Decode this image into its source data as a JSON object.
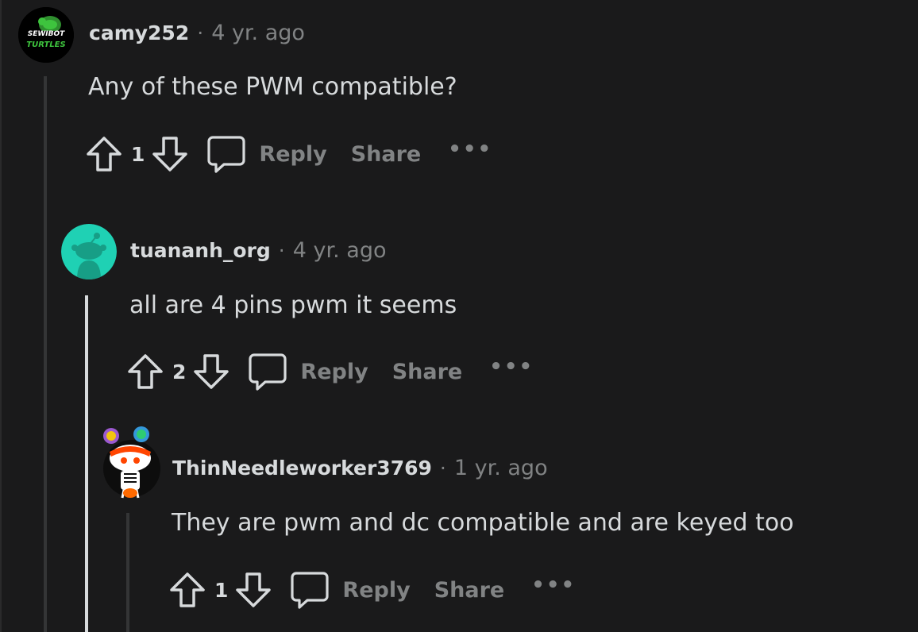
{
  "comments": [
    {
      "author": "camy252",
      "separator": "·",
      "time": "4 yr. ago",
      "body": "Any of these PWM compatible?",
      "score": "1",
      "reply_label": "Reply",
      "share_label": "Share",
      "more_label": "•••",
      "avatar_text_top": "SEWIBOT",
      "avatar_text_bottom": "TURTLES",
      "avatar_colors": {
        "bg": "#000000",
        "text": "#3ec43e"
      }
    },
    {
      "author": "tuananh_org",
      "separator": "·",
      "time": "4 yr. ago",
      "body": "all are 4 pins pwm it seems",
      "score": "2",
      "reply_label": "Reply",
      "share_label": "Share",
      "more_label": "•••",
      "avatar_colors": {
        "bg": "#1fd1b4",
        "figure": "#179e86"
      }
    },
    {
      "author": "ThinNeedleworker3769",
      "separator": "·",
      "time": "1 yr. ago",
      "body": "They are pwm and dc compatible and are keyed too",
      "score": "1",
      "reply_label": "Reply",
      "share_label": "Share",
      "more_label": "•••",
      "avatar_colors": {
        "bg": "#0d0d0d",
        "face": "#ffffff",
        "headband": "#ff4500"
      }
    }
  ],
  "icons": {
    "upvote": "upvote-arrow-icon",
    "downvote": "downvote-arrow-icon",
    "reply": "speech-bubble-icon",
    "more": "ellipsis-icon"
  },
  "colors": {
    "background": "#1a1a1b",
    "text": "#d7dadc",
    "muted": "#818384",
    "thread_line": "#343536",
    "thread_line_active": "#d7dadc"
  }
}
